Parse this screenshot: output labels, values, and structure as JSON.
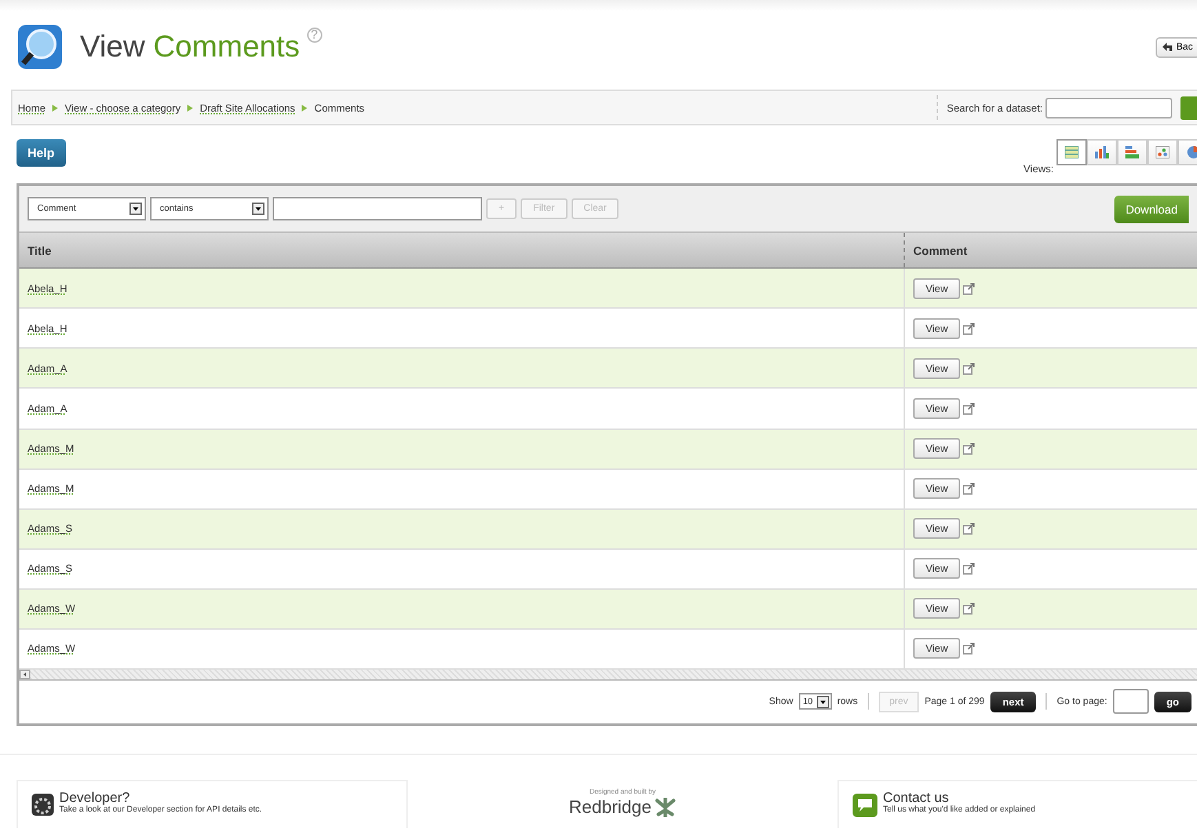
{
  "header": {
    "title_plain": "View",
    "title_accent": "Comments",
    "help_mark": "?",
    "back_button": "Bac"
  },
  "breadcrumb": [
    "Home",
    "View - choose a category",
    "Draft Site Allocations",
    "Comments"
  ],
  "search": {
    "label": "Search for a dataset:"
  },
  "help_button": "Help",
  "views": {
    "label": "Views:",
    "items": [
      {
        "kind": "table",
        "selected": true
      },
      {
        "kind": "bar",
        "selected": false
      },
      {
        "kind": "stack",
        "selected": false
      },
      {
        "kind": "scatter",
        "selected": false
      },
      {
        "kind": "pie",
        "selected": false
      }
    ]
  },
  "filter": {
    "field": "Comment",
    "operator": "contains",
    "add": "+",
    "filter": "Filter",
    "clear": "Clear",
    "download": "Download"
  },
  "table": {
    "columns": [
      "Title",
      "Comment"
    ],
    "rows": [
      {
        "title": "Abela_H",
        "action": "View"
      },
      {
        "title": "Abela_H",
        "action": "View"
      },
      {
        "title": "Adam_A",
        "action": "View"
      },
      {
        "title": "Adam_A",
        "action": "View"
      },
      {
        "title": "Adams_M",
        "action": "View"
      },
      {
        "title": "Adams_M",
        "action": "View"
      },
      {
        "title": "Adams_S",
        "action": "View"
      },
      {
        "title": "Adams_S",
        "action": "View"
      },
      {
        "title": "Adams_W",
        "action": "View"
      },
      {
        "title": "Adams_W",
        "action": "View"
      }
    ]
  },
  "pager": {
    "show": "Show",
    "rows_value": "10",
    "rows": "rows",
    "prev": "prev",
    "page": "Page 1 of 299",
    "next": "next",
    "goto": "Go to page:",
    "go": "go"
  },
  "footer": {
    "developer_title": "Developer?",
    "developer_text": "Take a look at our Developer section for API details etc.",
    "credit": "Designed and built by",
    "brand": "Redbridge",
    "contact_title": "Contact us",
    "contact_text": "Tell us what you'd like added or explained"
  }
}
